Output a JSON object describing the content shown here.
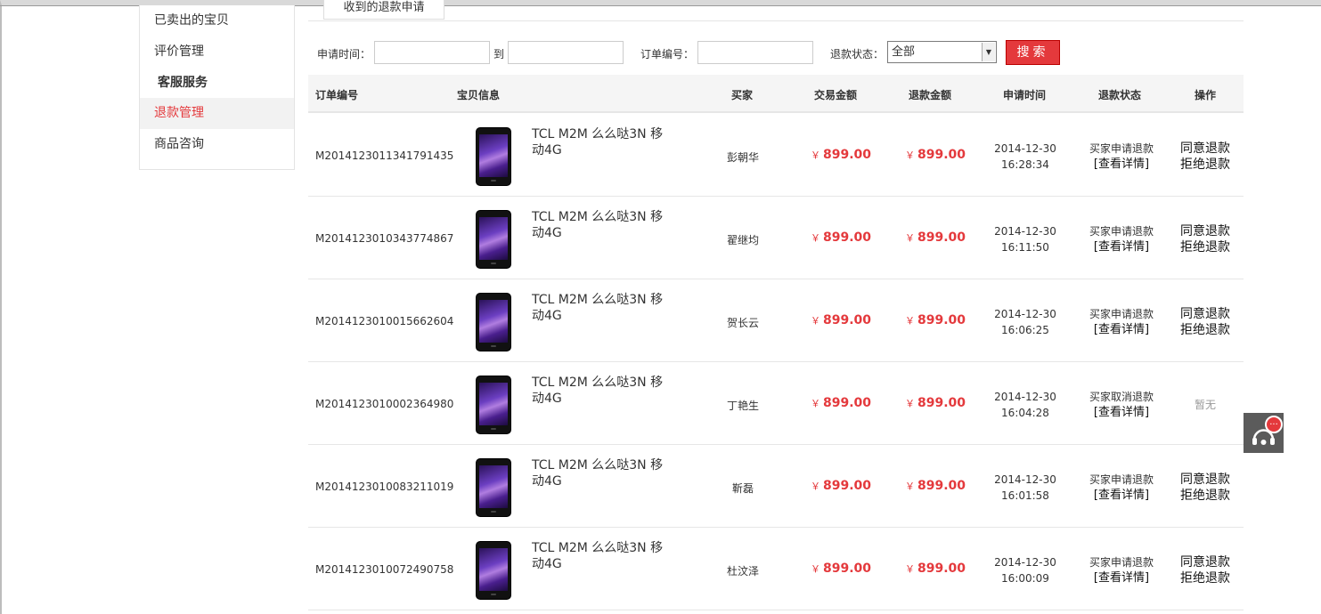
{
  "sidebar": {
    "items": [
      {
        "label": "已卖出的宝贝"
      },
      {
        "label": "评价管理"
      },
      {
        "label": "客服服务"
      },
      {
        "label": "退款管理"
      },
      {
        "label": "商品咨询"
      }
    ]
  },
  "tab": {
    "label": "收到的退款申请"
  },
  "filters": {
    "apply_time_label": "申请时间：",
    "to_label": "到",
    "order_no_label": "订单编号：",
    "status_label": "退款状态：",
    "status_value": "全部",
    "search_label": "搜索"
  },
  "table": {
    "headers": [
      "订单编号",
      "宝贝信息",
      "买家",
      "交易金额",
      "退款金额",
      "申请时间",
      "退款状态",
      "操作"
    ],
    "currency": "￥",
    "detail_label": "[查看详情]",
    "agree_label": "同意退款",
    "reject_label": "拒绝退款",
    "none_label": "暂无",
    "rows": [
      {
        "order": "M2014123011341791435",
        "product": "TCL M2M 么么哒3N 移动4G",
        "buyer": "彭朝华",
        "trade": "899.00",
        "refund": "899.00",
        "date": "2014-12-30",
        "time": "16:28:34",
        "status": "买家申请退款"
      },
      {
        "order": "M2014123010343774867",
        "product": "TCL M2M 么么哒3N 移动4G",
        "buyer": "翟继均",
        "trade": "899.00",
        "refund": "899.00",
        "date": "2014-12-30",
        "time": "16:11:50",
        "status": "买家申请退款"
      },
      {
        "order": "M2014123010015662604",
        "product": "TCL M2M 么么哒3N 移动4G",
        "buyer": "贺长云",
        "trade": "899.00",
        "refund": "899.00",
        "date": "2014-12-30",
        "time": "16:06:25",
        "status": "买家申请退款"
      },
      {
        "order": "M2014123010002364980",
        "product": "TCL M2M 么么哒3N 移动4G",
        "buyer": "丁艳生",
        "trade": "899.00",
        "refund": "899.00",
        "date": "2014-12-30",
        "time": "16:04:28",
        "status": "买家取消退款"
      },
      {
        "order": "M2014123010083211019",
        "product": "TCL M2M 么么哒3N 移动4G",
        "buyer": "靳磊",
        "trade": "899.00",
        "refund": "899.00",
        "date": "2014-12-30",
        "time": "16:01:58",
        "status": "买家申请退款"
      },
      {
        "order": "M2014123010072490758",
        "product": "TCL M2M 么么哒3N 移动4G",
        "buyer": "杜汶泽",
        "trade": "899.00",
        "refund": "899.00",
        "date": "2014-12-30",
        "time": "16:00:09",
        "status": "买家申请退款"
      }
    ]
  },
  "float": {
    "icon": "headset-service-icon",
    "badge": "..."
  },
  "colors": {
    "accent": "#e4393c"
  }
}
